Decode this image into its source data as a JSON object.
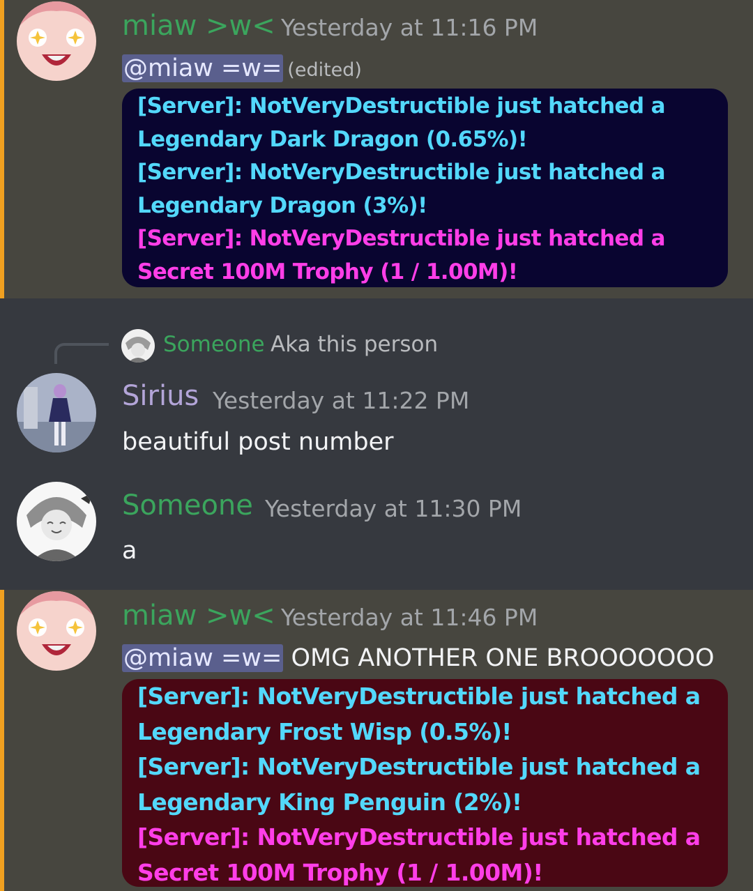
{
  "messages": [
    {
      "author": "miaw >w<",
      "timestamp": "Yesterday at 11:16 PM",
      "mention": "@miaw =w=",
      "edited": "(edited)",
      "text": "",
      "embed_lines": [
        "[Server]: NotVeryDestructible just hatched a",
        "Legendary Dark Dragon (0.65%)!",
        "[Server]: NotVeryDestructible just hatched a",
        "Legendary Dragon (3%)!",
        "[Server]: NotVeryDestructible just hatched a",
        "Secret 100M Trophy (1 / 1.00M)!"
      ]
    },
    {
      "reply": {
        "author": "Someone",
        "text": "Aka this person"
      },
      "author": "Sirius",
      "timestamp": "Yesterday at 11:22 PM",
      "text": "beautiful post number"
    },
    {
      "author": "Someone",
      "timestamp": "Yesterday at 11:30 PM",
      "text": "a"
    },
    {
      "author": "miaw >w<",
      "timestamp": "Yesterday at 11:46 PM",
      "mention": "@miaw =w=",
      "text": "OMG ANOTHER ONE BROOOOOOO",
      "embed_lines": [
        "[Server]: NotVeryDestructible just hatched a",
        "Legendary Frost Wisp (0.5%)!",
        "[Server]: NotVeryDestructible just hatched a",
        "Legendary King Penguin (2%)!",
        "[Server]: NotVeryDestructible just hatched a",
        "Secret 100M Trophy (1 / 1.00M)!"
      ]
    }
  ],
  "colors": {
    "background": "#36393f",
    "mention_highlight": "#47463f",
    "mention_bar": "#f0a020",
    "username_green": "#3ba55d",
    "username_purple": "#b3a5d8",
    "legendary_text": "#53d8fb",
    "secret_text": "#ff3ee8",
    "embed1_bg": "#090530",
    "embed2_bg": "#4a0714"
  }
}
